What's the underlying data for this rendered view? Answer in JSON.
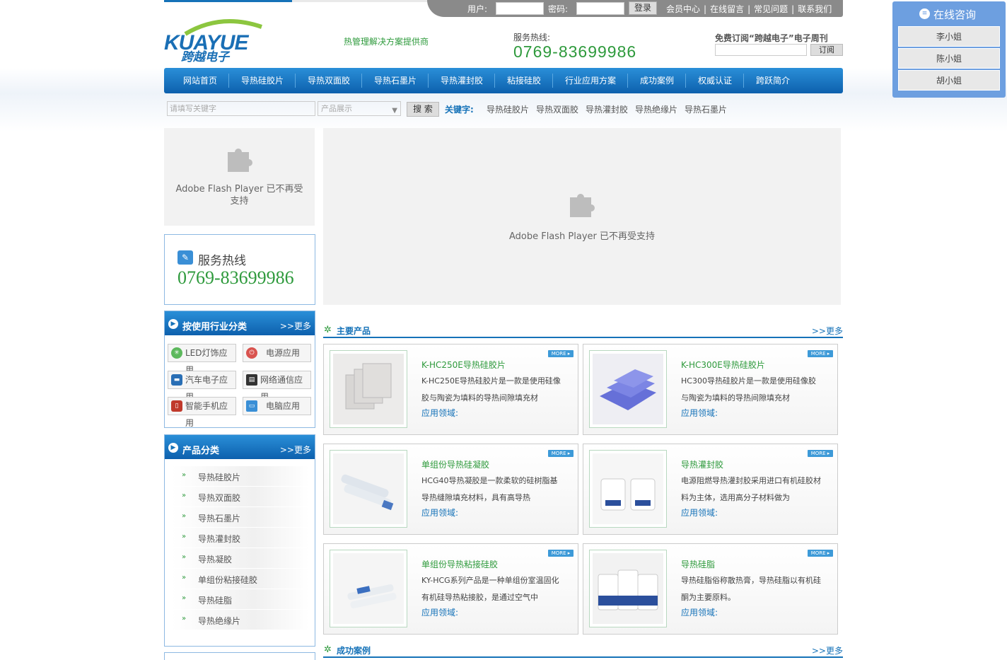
{
  "login": {
    "user_label": "用户:",
    "password_label": "密码:",
    "login_button": "登录",
    "links": [
      "会员中心",
      "在线留言",
      "常见问题",
      "联系我们"
    ],
    "separator": "|"
  },
  "header": {
    "logo_text": "KUAYUE",
    "logo_cn": "跨越电子",
    "slogan": "热管理解决方案提供商",
    "hotline_label": "服务热线:",
    "hotline_number": "0769-83699986",
    "subscribe_label": "免费订阅“跨越电子”电子周刊",
    "subscribe_button": "订阅"
  },
  "nav": [
    "网站首页",
    "导热硅胶片",
    "导热双面胶",
    "导热石墨片",
    "导热灌封胶",
    "粘接硅胶",
    "行业应用方案",
    "成功案例",
    "权威认证",
    "跨跃简介"
  ],
  "search": {
    "placeholder": "请填写关键字",
    "select_value": "产品展示",
    "button": "搜 索",
    "keywords_label": "关键字:",
    "keywords": [
      "导热硅胶片",
      "导热双面胶",
      "导热灌封胶",
      "导热绝缘片",
      "导热石墨片"
    ]
  },
  "flash": {
    "left_text": "Adobe Flash Player 已不再受支持",
    "main_text": "Adobe Flash Player 已不再受支持"
  },
  "hotbox": {
    "title": "服务热线",
    "number": "0769-83699986"
  },
  "industry": {
    "title": "按使用行业分类",
    "more": ">>更多",
    "items": [
      "LED灯饰应用",
      "电源应用",
      "汽车电子应用",
      "网络通信应用",
      "智能手机应用",
      "电脑应用"
    ]
  },
  "product_categories": {
    "title": "产品分类",
    "more": ">>更多",
    "items": [
      "导热硅胶片",
      "导热双面胶",
      "导热石墨片",
      "导热灌封胶",
      "导热凝胶",
      "单组份粘接硅胶",
      "导热硅脂",
      "导热绝缘片"
    ]
  },
  "main_products": {
    "title": "主要产品",
    "more": ">>更多",
    "more_badge": "MORE ▸",
    "app_label": "应用领域:",
    "items": [
      {
        "name": "K-HC250E导热硅胶片",
        "desc": "K-HC250E导热硅胶片是一款是使用硅像胶与陶瓷为填料的导热间隙填充材"
      },
      {
        "name": "K-HC300E导热硅胶片",
        "desc": "HC300导热硅胶片是一款是使用硅像胶与陶瓷为填料的导热间隙填充材"
      },
      {
        "name": "单组份导热硅凝胶",
        "desc": "HCG40导热凝胶是一款柔软的硅树脂基导热缝隙填充材料，具有高导热"
      },
      {
        "name": "导热灌封胶",
        "desc": "电源阻燃导热灌封胶采用进口有机硅胶材料为主体，选用高分子材料做为"
      },
      {
        "name": "单组份导热粘接硅胶",
        "desc": "KY-HCG系列产品是一种单组份室温固化有机硅导热粘接胶，是通过空气中"
      },
      {
        "name": "导热硅脂",
        "desc": "导热硅脂俗称散热膏，导热硅脂以有机硅酮为主要原料。"
      }
    ]
  },
  "success_cases": {
    "title": "成功案例",
    "more": ">>更多"
  },
  "consult": {
    "title": "在线咨询",
    "people": [
      "李小姐",
      "陈小姐",
      "胡小姐"
    ]
  },
  "colors": {
    "brand_blue": "#1572b8",
    "brand_green": "#2e9a3c",
    "consult_blue": "#6d9fe0"
  }
}
